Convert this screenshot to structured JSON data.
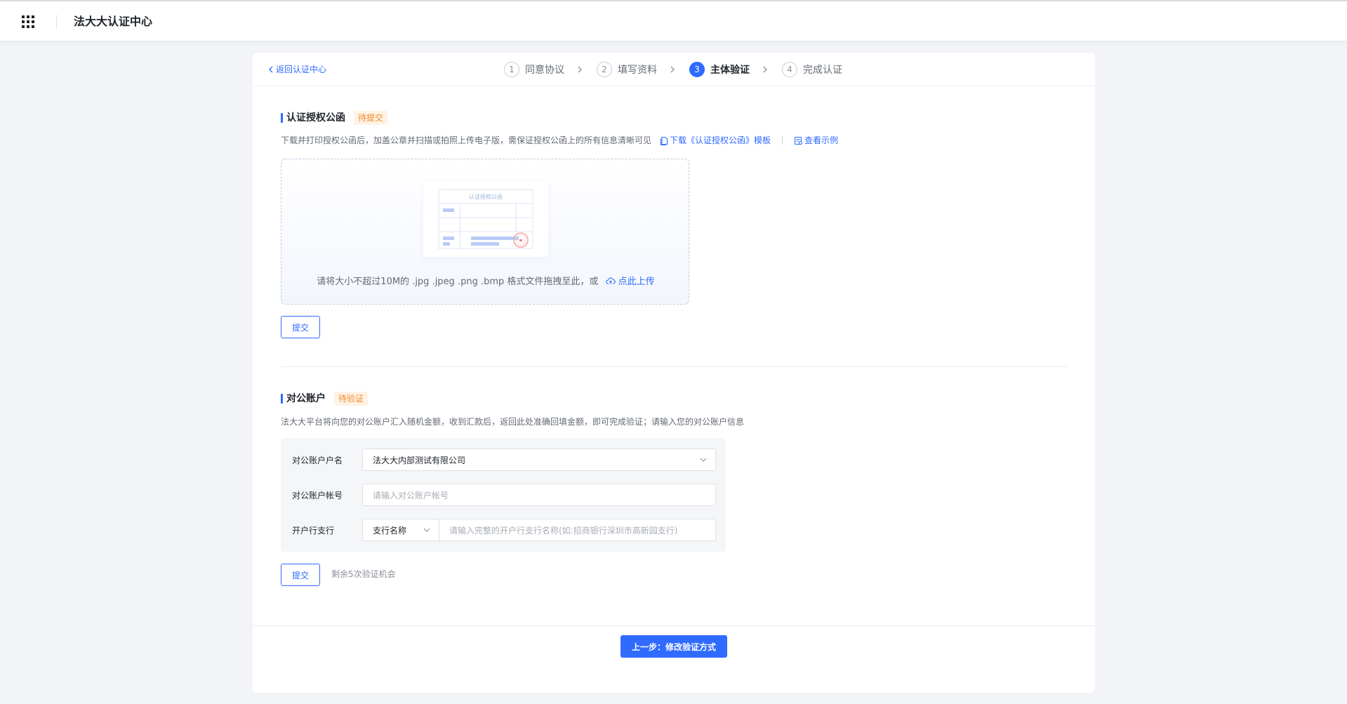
{
  "app": {
    "title": "法大大认证中心"
  },
  "header": {
    "back_label": "返回认证中心",
    "steps": [
      {
        "num": "1",
        "label": "同意协议"
      },
      {
        "num": "2",
        "label": "填写资料"
      },
      {
        "num": "3",
        "label": "主体验证"
      },
      {
        "num": "4",
        "label": "完成认证"
      }
    ],
    "active_step": 3
  },
  "auth_letter": {
    "title": "认证授权公函",
    "badge": "待提交",
    "desc": "下载并打印授权公函后，加盖公章并扫描或拍照上传电子版，需保证授权公函上的所有信息清晰可见",
    "download_link": "下载《认证授权公函》模板",
    "example_link": "查看示例",
    "preview_title": "认证授权公函",
    "upload_hint": "请将大小不超过10M的 .jpg .jpeg .png .bmp 格式文件拖拽至此，或",
    "upload_link": "点此上传",
    "submit_label": "提交"
  },
  "account": {
    "title": "对公账户",
    "badge": "待验证",
    "desc": "法大大平台将向您的对公账户汇入随机金额，收到汇款后，返回此处准确回填金额，即可完成验证；请输入您的对公账户信息",
    "name_label": "对公账户户名",
    "name_value": "法大大内部测试有限公司",
    "number_label": "对公账户帐号",
    "number_placeholder": "请输入对公账户帐号",
    "bank_label": "开户行支行",
    "bank_select": "支行名称",
    "bank_placeholder": "请输入完整的开户行支行名称(如:招商银行深圳市高新园支行)",
    "submit_label": "提交",
    "remaining": "剩余5次验证机会"
  },
  "footer": {
    "prev_label": "上一步：修改验证方式"
  },
  "colors": {
    "primary": "#2f6bff",
    "warning": "#f08c2e",
    "warning_bg": "#fff3e6"
  }
}
